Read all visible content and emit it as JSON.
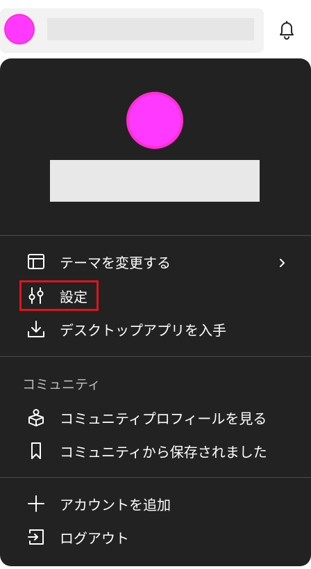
{
  "menu": {
    "theme_item": {
      "label": "テーマを変更する",
      "icon": "layout-icon"
    },
    "settings_item": {
      "label": "設定",
      "icon": "sliders-icon"
    },
    "desktop_app_item": {
      "label": "デスクトップアプリを入手",
      "icon": "download-icon"
    },
    "community_section": {
      "header": "コミュニティ",
      "view_profile_item": {
        "label": "コミュニティプロフィールを見る",
        "icon": "cube-person-icon"
      },
      "saved_item": {
        "label": "コミュニティから保存されました",
        "icon": "bookmark-icon"
      }
    },
    "add_account_item": {
      "label": "アカウントを追加",
      "icon": "plus-icon"
    },
    "logout_item": {
      "label": "ログアウト",
      "icon": "logout-icon"
    }
  },
  "colors": {
    "menu_background": "#222222",
    "avatar": "#ff39ff",
    "highlight": "#e0141a"
  }
}
